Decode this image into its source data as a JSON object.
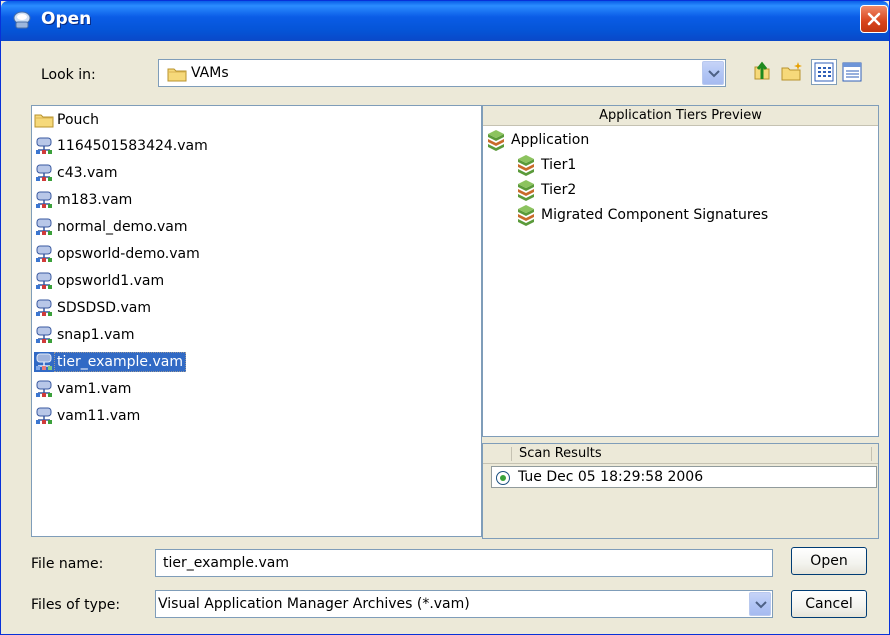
{
  "window": {
    "title": "Open"
  },
  "lookin": {
    "label": "Look in:",
    "value": "VAMs",
    "tools": [
      "up-one-level-icon",
      "create-new-folder-icon",
      "list-view-icon",
      "details-view-icon"
    ]
  },
  "files": [
    {
      "name": "Pouch",
      "type": "folder"
    },
    {
      "name": "1164501583424.vam",
      "type": "vam"
    },
    {
      "name": "c43.vam",
      "type": "vam"
    },
    {
      "name": "m183.vam",
      "type": "vam"
    },
    {
      "name": "normal_demo.vam",
      "type": "vam"
    },
    {
      "name": "opsworld-demo.vam",
      "type": "vam"
    },
    {
      "name": "opsworld1.vam",
      "type": "vam"
    },
    {
      "name": "SDSDSD.vam",
      "type": "vam"
    },
    {
      "name": "snap1.vam",
      "type": "vam"
    },
    {
      "name": "tier_example.vam",
      "type": "vam",
      "selected": true
    },
    {
      "name": "vam1.vam",
      "type": "vam"
    },
    {
      "name": "vam11.vam",
      "type": "vam"
    }
  ],
  "preview": {
    "header": "Application Tiers Preview",
    "root": "Application",
    "children": [
      "Tier1",
      "Tier2",
      "Migrated Component Signatures"
    ]
  },
  "scan": {
    "header": "Scan Results",
    "entries": [
      "Tue Dec 05 18:29:58 2006"
    ]
  },
  "bottom": {
    "filename_label": "File name:",
    "filename_value": "tier_example.vam",
    "filetype_label": "Files of type:",
    "filetype_value": "Visual Application Manager Archives (*.vam)",
    "open_label": "Open",
    "cancel_label": "Cancel"
  },
  "colors": {
    "titlebar": "#0a5ce6",
    "selection": "#316ac5",
    "dialog_bg": "#ece9d8",
    "border": "#7f9db9"
  }
}
